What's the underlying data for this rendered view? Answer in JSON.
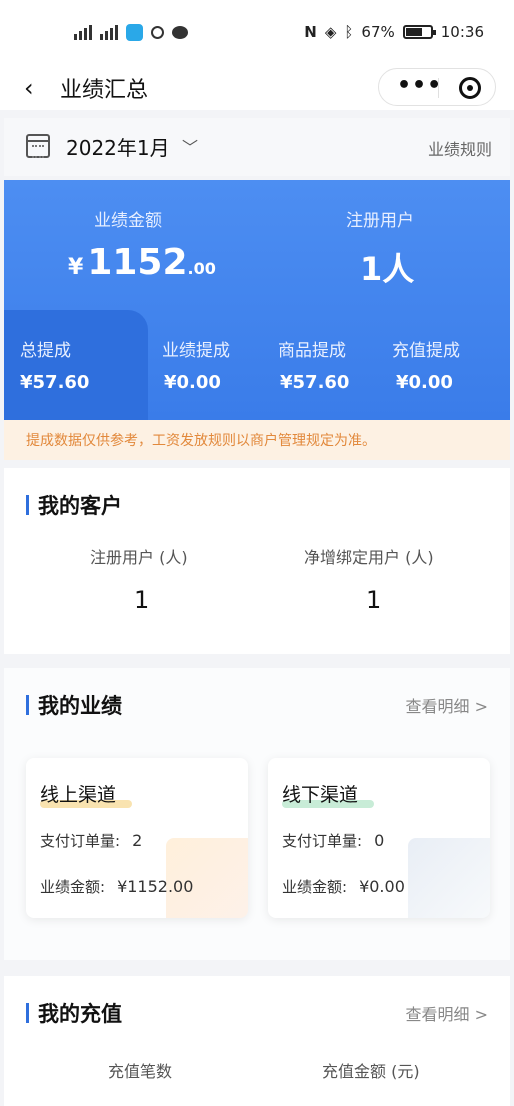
{
  "status_bar": {
    "battery": "67%",
    "time": "10:36"
  },
  "nav": {
    "back_icon": "chevron-left-icon",
    "title": "业绩汇总",
    "more_icon": "more-dots-icon",
    "close_icon": "target-close-icon"
  },
  "date_bar": {
    "calendar_icon": "calendar-icon",
    "date": "2022年1月",
    "rules_link": "业绩规则"
  },
  "summary": {
    "amount_label": "业绩金额",
    "amount_currency": "¥",
    "amount_integer": "1152",
    "amount_decimal": ".00",
    "users_label": "注册用户",
    "users_value": "1人"
  },
  "commission_tabs": [
    {
      "label": "总提成",
      "value": "¥57.60"
    },
    {
      "label": "业绩提成",
      "value": "¥0.00"
    },
    {
      "label": "商品提成",
      "value": "¥57.60"
    },
    {
      "label": "充值提成",
      "value": "¥0.00"
    }
  ],
  "notice": "提成数据仅供参考，工资发放规则以商户管理规定为准。",
  "customers": {
    "title": "我的客户",
    "stats": [
      {
        "label": "注册用户 (人)",
        "value": "1"
      },
      {
        "label": "净增绑定用户 (人)",
        "value": "1"
      }
    ]
  },
  "performance": {
    "title": "我的业绩",
    "detail_link": "查看明细 >",
    "channels": [
      {
        "title": "线上渠道",
        "orders_label": "支付订单量:",
        "orders_value": "2",
        "amount_label": "业绩金额:",
        "amount_value": "¥1152.00"
      },
      {
        "title": "线下渠道",
        "orders_label": "支付订单量:",
        "orders_value": "0",
        "amount_label": "业绩金额:",
        "amount_value": "¥0.00"
      }
    ]
  },
  "recharge": {
    "title": "我的充值",
    "detail_link": "查看明细 >",
    "stats": [
      {
        "label": "充值笔数"
      },
      {
        "label": "充值金额 (元)"
      }
    ]
  },
  "colors": {
    "primary_blue": "#3a7ce9",
    "active_tab": "#2f6fdd",
    "notice_bg": "#fdf1e3",
    "notice_text": "#e2893c",
    "online_highlight": "#f9e3b0",
    "offline_highlight": "#c8ecd7"
  }
}
